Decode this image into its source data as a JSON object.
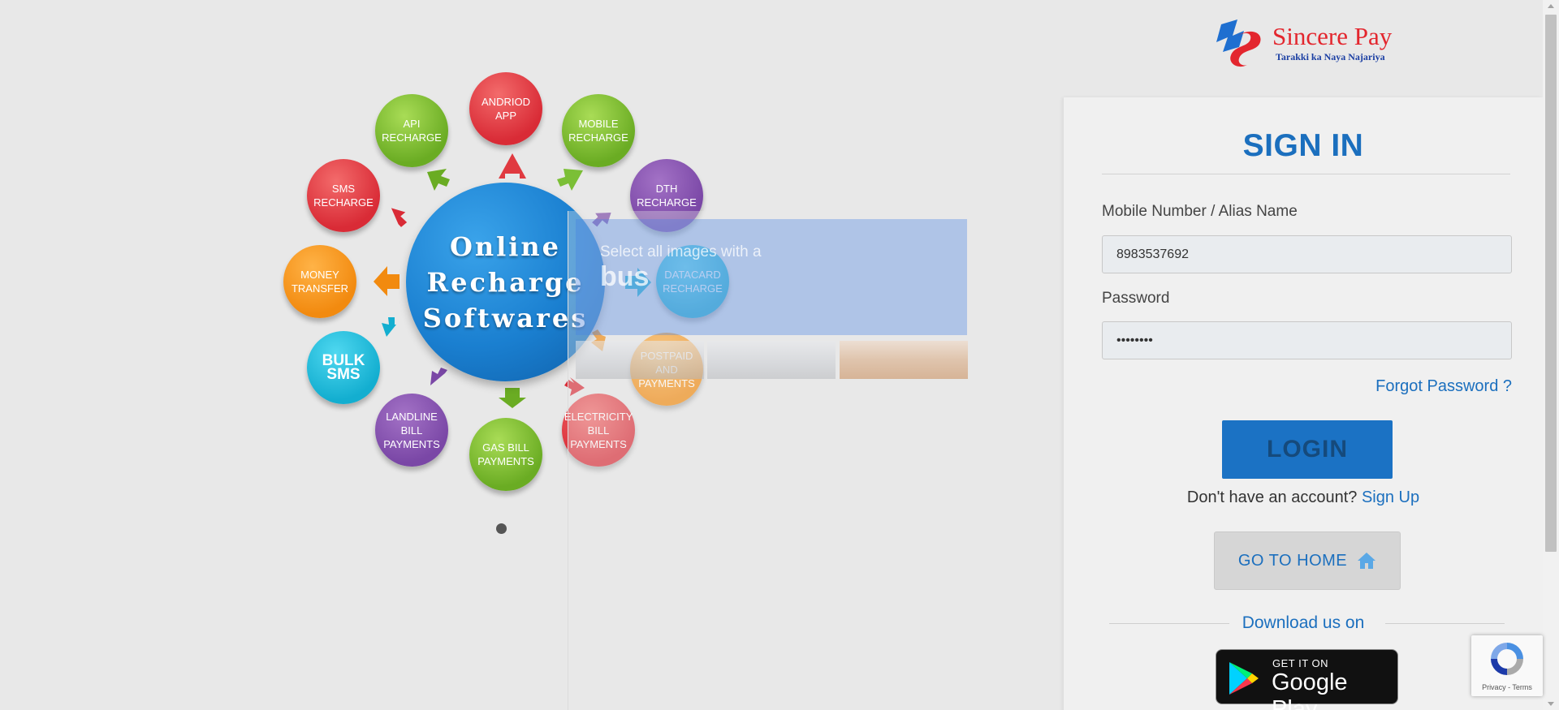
{
  "hero": {
    "center_line1": "Online",
    "center_line2": "Recharge",
    "center_line3": "Softwares",
    "bubbles": {
      "andriod_app": "ANDRIOD APP",
      "mobile_recharge": "MOBILE RECHARGE",
      "dth_recharge": "DTH RECHARGE",
      "datacard_recharge": "DATACARD RECHARGE",
      "postpaid_payments": "POSTPAID AND PAYMENTS",
      "electricity_bill": "ELECTRICITY BILL PAYMENTS",
      "gas_bill": "GAS BILL PAYMENTS",
      "landline_bill": "LANDLINE BILL PAYMENTS",
      "bulk_sms": "BULK SMS",
      "money_transfer": "MONEY TRANSFER",
      "sms_recharge": "SMS RECHARGE",
      "api_recharge": "API RECHARGE"
    }
  },
  "captcha": {
    "instruction": "Select all images with a",
    "target": "bus"
  },
  "brand": {
    "name": "Sincere Pay",
    "tagline": "Tarakki ka Naya Najariya"
  },
  "login": {
    "title": "SIGN IN",
    "mobile_label": "Mobile Number / Alias Name",
    "mobile_value": "8983537692",
    "password_label": "Password",
    "password_value": "••••••••",
    "forgot_link": "Forgot Password ?",
    "login_button": "LOGIN",
    "no_account_text": "Don't have an account?",
    "signup_link": "Sign Up",
    "home_button": "GO TO HOME",
    "download_text": "Download us on",
    "gplay_small": "GET IT ON",
    "gplay_big": "Google Play"
  },
  "recaptcha": {
    "privacy": "Privacy",
    "separator": " - ",
    "terms": "Terms"
  },
  "colors": {
    "accent": "#1b6fbe",
    "brand_red": "#e3262e",
    "brand_blue": "#1b3fa3",
    "login_button": "#1b72c4",
    "page_background": "#e8e8e8"
  }
}
